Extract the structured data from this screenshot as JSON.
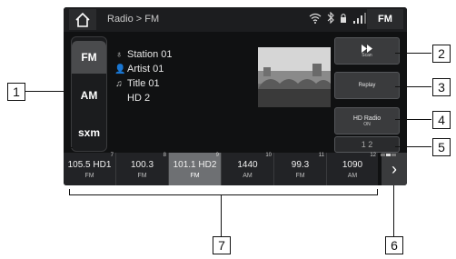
{
  "topbar": {
    "breadcrumb": "Radio > FM",
    "status_icons": [
      "wifi-icon",
      "bluetooth-icon",
      "lock-icon",
      "signal-icon"
    ],
    "band_chip": "FM"
  },
  "bands": [
    "FM",
    "AM",
    "sxm"
  ],
  "station_info": {
    "station": "Station 01",
    "artist": "Artist 01",
    "title": "Title 01",
    "hd": "HD 2"
  },
  "buttons": {
    "scan": "Scan",
    "replay": "Replay",
    "hd_radio": "HD Radio",
    "hd_radio_state": "ON",
    "page_indicator": "1 2"
  },
  "presets": [
    {
      "num": "7",
      "freq": "105.5 HD1",
      "band": "FM"
    },
    {
      "num": "8",
      "freq": "100.3",
      "band": "FM"
    },
    {
      "num": "9",
      "freq": "101.1 HD2",
      "band": "FM"
    },
    {
      "num": "10",
      "freq": "1440",
      "band": "AM"
    },
    {
      "num": "11",
      "freq": "99.3",
      "band": "FM"
    },
    {
      "num": "12",
      "freq": "1090",
      "band": "AM"
    }
  ],
  "callouts": [
    "1",
    "2",
    "3",
    "4",
    "5",
    "6",
    "7"
  ],
  "colors": {
    "screen_bg": "#101112",
    "selected_preset": "#6e7073"
  }
}
